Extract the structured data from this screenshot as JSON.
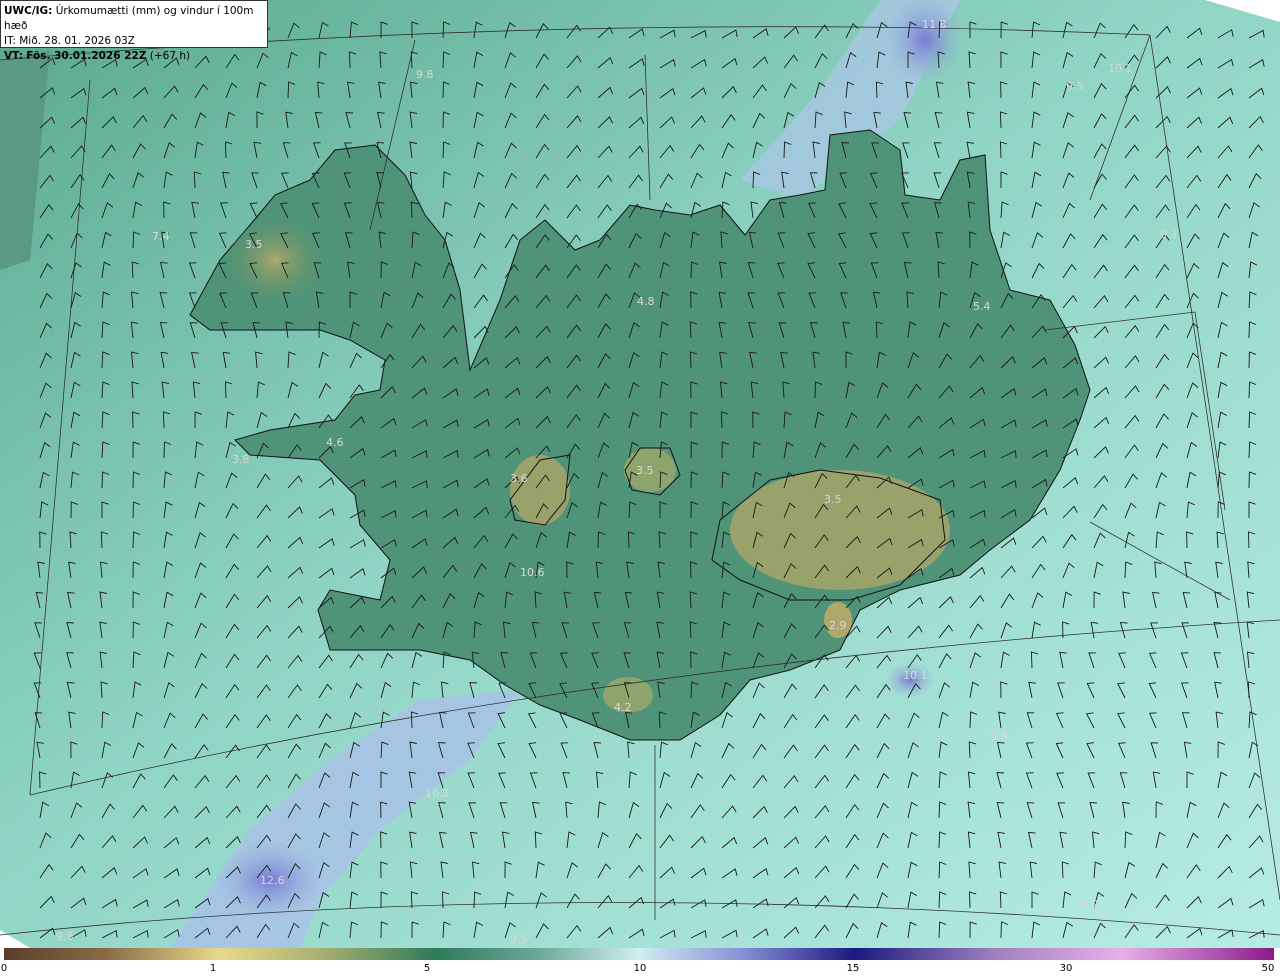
{
  "header": {
    "product": "UWC/IG:",
    "title": "Úrkomumætti (mm) og vindur í 100m hæð",
    "issue_time": "IT: Mið. 28. 01. 2026 03Z",
    "valid_prefix": "VT:",
    "valid_time": "Fös. 30.01.2026 22Z",
    "lead_time": "(+67 h)"
  },
  "colorbar": {
    "ticks": [
      "0",
      "1",
      "5",
      "10",
      "15",
      "30",
      "50"
    ],
    "colors": [
      "#5a3e2b",
      "#b08a55",
      "#e8d98a",
      "#6a9a5a",
      "#2e7a5a",
      "#9ee0d4",
      "#cfeff0",
      "#6b6fd0",
      "#20208a",
      "#e0a0e0",
      "#8a1a8a"
    ]
  },
  "colors": {
    "land": "#6f9a6a",
    "highland": "#9aa36a",
    "sea": "#8fd4c4",
    "moist_band": "#8a9ad8",
    "coast": "#111111",
    "grid": "#333333"
  },
  "map_values": [
    {
      "id": "v1",
      "text": "11.8"
    },
    {
      "id": "v2",
      "text": "9.8"
    },
    {
      "id": "v3",
      "text": "10.1"
    },
    {
      "id": "v4",
      "text": "9.5"
    },
    {
      "id": "v5",
      "text": "7.4"
    },
    {
      "id": "v6",
      "text": "3.5"
    },
    {
      "id": "v7",
      "text": "4.8"
    },
    {
      "id": "v8",
      "text": "5.4"
    },
    {
      "id": "v9",
      "text": "9.3"
    },
    {
      "id": "v10",
      "text": "4.6"
    },
    {
      "id": "v11",
      "text": "3.8"
    },
    {
      "id": "v12",
      "text": "3.6"
    },
    {
      "id": "v13",
      "text": "3.5"
    },
    {
      "id": "v14",
      "text": "3.5"
    },
    {
      "id": "v15",
      "text": "10.6"
    },
    {
      "id": "v16",
      "text": "2.9"
    },
    {
      "id": "v17",
      "text": "4.2"
    },
    {
      "id": "v18",
      "text": "10.1"
    },
    {
      "id": "v19",
      "text": "9.8"
    },
    {
      "id": "v20",
      "text": "10.2"
    },
    {
      "id": "v21",
      "text": "12.6"
    },
    {
      "id": "v22",
      "text": "9.8"
    },
    {
      "id": "v23",
      "text": "9.5"
    },
    {
      "id": "v24",
      "text": "10.2"
    }
  ]
}
